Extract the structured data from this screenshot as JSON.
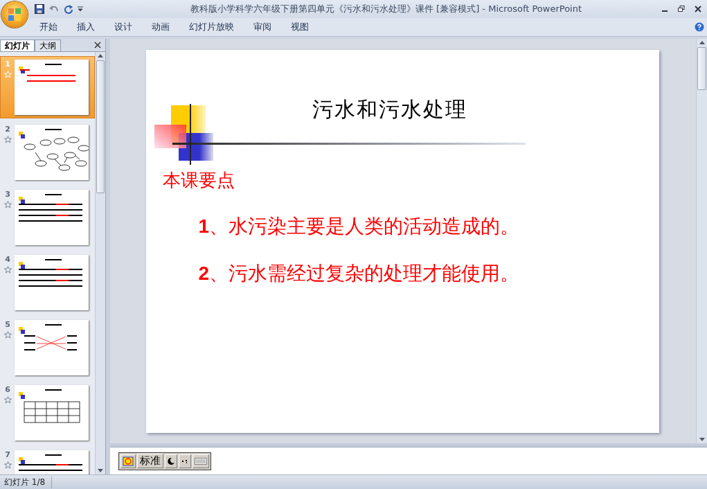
{
  "window": {
    "title": "教科版小学科学六年级下册第四单元《污水和污水处理》课件 [兼容模式] - Microsoft PowerPoint"
  },
  "ribbon_tabs": [
    {
      "label": "开始",
      "selected": false
    },
    {
      "label": "插入",
      "selected": false
    },
    {
      "label": "设计",
      "selected": false
    },
    {
      "label": "动画",
      "selected": false
    },
    {
      "label": "幻灯片放映",
      "selected": false
    },
    {
      "label": "审阅",
      "selected": false
    },
    {
      "label": "视图",
      "selected": false
    }
  ],
  "panel_tabs": [
    {
      "label": "幻灯片",
      "selected": true
    },
    {
      "label": "大纲",
      "selected": false
    }
  ],
  "slides": [
    {
      "number": "1",
      "selected": true,
      "kind": "points"
    },
    {
      "number": "2",
      "selected": false,
      "kind": "diagram"
    },
    {
      "number": "3",
      "selected": false,
      "kind": "text"
    },
    {
      "number": "4",
      "selected": false,
      "kind": "text"
    },
    {
      "number": "5",
      "selected": false,
      "kind": "matching"
    },
    {
      "number": "6",
      "selected": false,
      "kind": "table"
    },
    {
      "number": "7",
      "selected": false,
      "kind": "text"
    }
  ],
  "slide": {
    "title": "污水和污水处理",
    "subtitle": "本课要点",
    "points": [
      {
        "number": "1",
        "text": "、水污染主要是人类的活动造成的。"
      },
      {
        "number": "2",
        "text": "、污水需经过复杂的处理才能使用。"
      }
    ]
  },
  "ime_toolbar": {
    "mode": "标准"
  },
  "status_bar": {
    "text": "幻灯片 1/8"
  }
}
